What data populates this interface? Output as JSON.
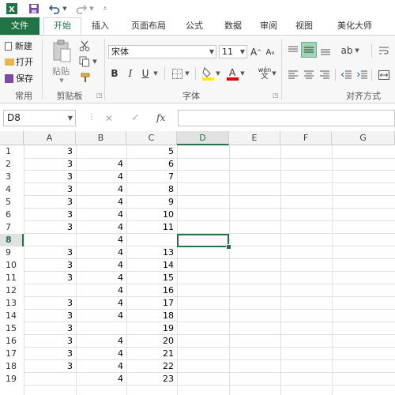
{
  "quick_access": {
    "excel_icon": "excel-icon",
    "save_icon": "save-icon",
    "undo_icon": "undo-icon",
    "redo_icon": "redo-icon",
    "customize_icon": "customize-icon"
  },
  "tabs": [
    {
      "label": "文件"
    },
    {
      "label": "开始"
    },
    {
      "label": "插入"
    },
    {
      "label": "页面布局"
    },
    {
      "label": "公式"
    },
    {
      "label": "数据"
    },
    {
      "label": "审阅"
    },
    {
      "label": "视图"
    },
    {
      "label": "美化大师"
    }
  ],
  "ribbon": {
    "common": {
      "new_label": "新建",
      "open_label": "打开",
      "save_label": "保存",
      "group_label": "常用"
    },
    "clipboard": {
      "paste_label": "粘贴",
      "group_label": "剪贴板"
    },
    "font": {
      "font_name": "宋体",
      "font_size": "11",
      "bold": "B",
      "italic": "I",
      "underline": "U",
      "grow": "A",
      "shrink": "A",
      "phonetic": "wén",
      "group_label": "字体"
    },
    "alignment": {
      "group_label": "对齐方式"
    }
  },
  "formula_bar": {
    "name_box": "D8",
    "cancel": "✕",
    "enter": "✓",
    "fx": "fx",
    "value": ""
  },
  "sheet": {
    "columns": [
      "A",
      "B",
      "C",
      "D",
      "E",
      "F",
      "G"
    ],
    "selected_cell": "D8",
    "rows": [
      {
        "n": "1",
        "A": "3",
        "B": "",
        "C": "5"
      },
      {
        "n": "2",
        "A": "3",
        "B": "4",
        "C": "6"
      },
      {
        "n": "3",
        "A": "3",
        "B": "4",
        "C": "7"
      },
      {
        "n": "4",
        "A": "3",
        "B": "4",
        "C": "8"
      },
      {
        "n": "5",
        "A": "3",
        "B": "4",
        "C": "9"
      },
      {
        "n": "6",
        "A": "3",
        "B": "4",
        "C": "10"
      },
      {
        "n": "7",
        "A": "3",
        "B": "4",
        "C": "11"
      },
      {
        "n": "8",
        "A": "",
        "B": "4",
        "C": ""
      },
      {
        "n": "9",
        "A": "3",
        "B": "4",
        "C": "13"
      },
      {
        "n": "10",
        "A": "3",
        "B": "4",
        "C": "14"
      },
      {
        "n": "11",
        "A": "3",
        "B": "4",
        "C": "15"
      },
      {
        "n": "12",
        "A": "",
        "B": "4",
        "C": "16"
      },
      {
        "n": "13",
        "A": "3",
        "B": "4",
        "C": "17"
      },
      {
        "n": "14",
        "A": "3",
        "B": "4",
        "C": "18"
      },
      {
        "n": "15",
        "A": "3",
        "B": "",
        "C": "19"
      },
      {
        "n": "16",
        "A": "3",
        "B": "4",
        "C": "20"
      },
      {
        "n": "17",
        "A": "3",
        "B": "4",
        "C": "21"
      },
      {
        "n": "18",
        "A": "3",
        "B": "4",
        "C": "22"
      },
      {
        "n": "19",
        "A": "",
        "B": "4",
        "C": "23"
      }
    ]
  },
  "colors": {
    "accent": "#217346",
    "grid": "#e1e1e1",
    "header_bg": "#f3f3f3"
  }
}
